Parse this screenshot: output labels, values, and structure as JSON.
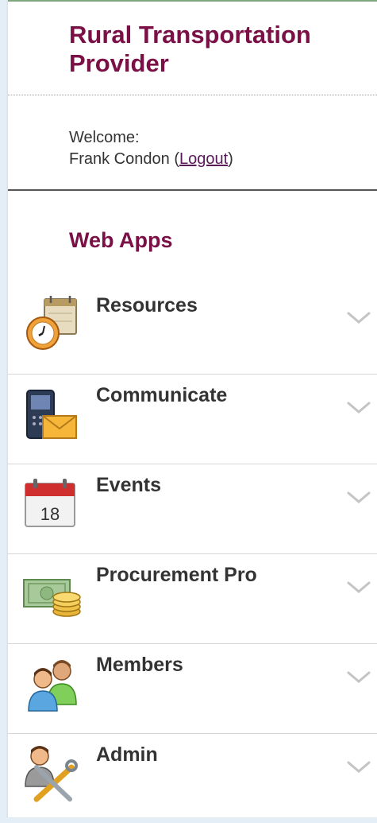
{
  "org": {
    "name": "Rural Transportation Provider"
  },
  "welcome": {
    "prefix": "Welcome:",
    "user": "Frank Condon",
    "open_paren": "(",
    "logout": "Logout",
    "close_paren": ")"
  },
  "section": {
    "title": "Web Apps"
  },
  "apps": [
    {
      "label": "Resources",
      "icon": "clock-calendar-icon"
    },
    {
      "label": "Communicate",
      "icon": "phone-mail-icon"
    },
    {
      "label": "Events",
      "icon": "calendar-icon",
      "calendar_day": "18"
    },
    {
      "label": "Procurement Pro",
      "icon": "money-coins-icon"
    },
    {
      "label": "Members",
      "icon": "users-icon"
    },
    {
      "label": "Admin",
      "icon": "admin-tools-icon"
    }
  ],
  "colors": {
    "accent": "#7a1045",
    "text": "#333333",
    "link": "#5a1a5a"
  }
}
